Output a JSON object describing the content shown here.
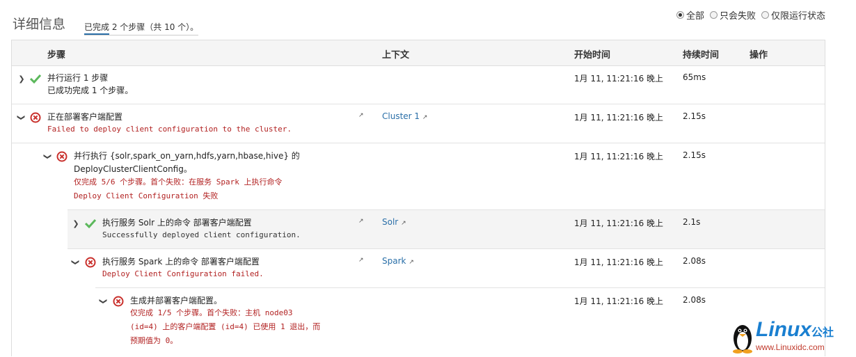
{
  "header": {
    "title": "详细信息",
    "progress_done": "已完成",
    "progress_rest": " 2 个步骤（共 10 个）。",
    "filters": [
      {
        "label": "全部",
        "checked": true
      },
      {
        "label": "只会失败",
        "checked": false
      },
      {
        "label": "仅限运行状态",
        "checked": false
      }
    ]
  },
  "columns": {
    "step": "步骤",
    "context": "上下文",
    "start": "开始时间",
    "duration": "持续时间",
    "action": "操作"
  },
  "rows": [
    {
      "expanded": false,
      "status": "success",
      "title": "并行运行 1 步骤",
      "message": "已成功完成 1 个步骤。",
      "message_style": "dark-plain",
      "context": "",
      "start": "1月 11, 11:21:16 晚上",
      "duration": "65ms"
    },
    {
      "expanded": true,
      "status": "error",
      "title": "正在部署客户端配置",
      "message": "Failed to deploy client configuration to the cluster.",
      "context": "Cluster 1",
      "start": "1月 11, 11:21:16 晚上",
      "duration": "2.15s"
    },
    {
      "expanded": true,
      "status": "error",
      "title_line1": "并行执行 {solr,spark_on_yarn,hdfs,yarn,hbase,hive} 的",
      "title_line2": "DeployClusterClientConfig。",
      "message_line1": "仅完成 5/6 个步骤。首个失败：在服务 Spark 上执行命令",
      "message_line2": "Deploy Client Configuration 失败",
      "context": "",
      "start": "1月 11, 11:21:16 晚上",
      "duration": "2.15s"
    },
    {
      "expanded": false,
      "status": "success",
      "title": "执行服务 Solr 上的命令 部署客户端配置",
      "message": "Successfully deployed client configuration.",
      "context": "Solr",
      "start": "1月 11, 11:21:16 晚上",
      "duration": "2.1s"
    },
    {
      "expanded": true,
      "status": "error",
      "title": "执行服务 Spark 上的命令 部署客户端配置",
      "message": "Deploy Client Configuration failed.",
      "context": "Spark",
      "start": "1月 11, 11:21:16 晚上",
      "duration": "2.08s"
    },
    {
      "expanded": true,
      "status": "error",
      "title": "生成并部署客户端配置。",
      "message_line1": "仅完成 1/5 个步骤。首个失败：主机 node03",
      "message_line2": "(id=4) 上的客户端配置 (id=4) 已使用 1 退出，而",
      "message_line3": "预期值为 0。",
      "context": "",
      "start": "1月 11, 11:21:16 晚上",
      "duration": "2.08s"
    }
  ],
  "watermark": {
    "brand": "Linux",
    "suffix": "公社",
    "url": "www.Linuxidc.com"
  },
  "colors": {
    "success": "#5cb85c",
    "error": "#c9302c",
    "link": "#2a6fa8",
    "error_text": "#b22222"
  },
  "icons": {
    "success": "checkmark-icon",
    "error": "error-circle-x-icon",
    "external": "external-link-icon",
    "expand": "chevron-icon"
  }
}
